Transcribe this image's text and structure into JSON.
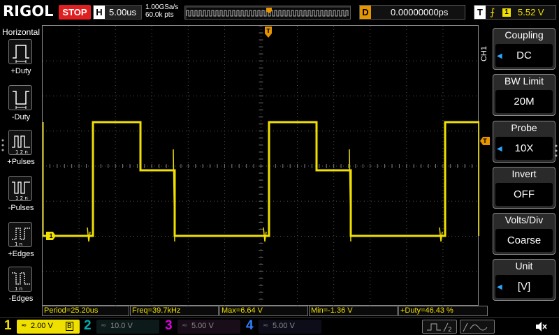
{
  "header": {
    "brand": "RIGOL",
    "run_state": "STOP",
    "horizontal_key": "H",
    "timebase": "5.00us",
    "sample_rate": "1.00GSa/s",
    "memory_depth": "60.0k pts",
    "delay_key": "D",
    "delay_value": "0.00000000ps",
    "trigger_key": "T",
    "trigger_source": "1",
    "trigger_level": "5.52 V"
  },
  "left_panel": {
    "title": "Horizontal",
    "items": [
      {
        "label": "+Duty",
        "icon": "positive-duty-icon"
      },
      {
        "label": "-Duty",
        "icon": "negative-duty-icon"
      },
      {
        "label": "+Pulses",
        "icon": "positive-pulses-icon"
      },
      {
        "label": "-Pulses",
        "icon": "negative-pulses-icon"
      },
      {
        "label": "+Edges",
        "icon": "positive-edges-icon"
      },
      {
        "label": "-Edges",
        "icon": "negative-edges-icon"
      }
    ]
  },
  "grid": {
    "channel_marker": "1",
    "trigger_marker": "T"
  },
  "measurements": {
    "period": "Period=25.20us",
    "freq": "Freq=39.7kHz",
    "max": "Max=6.64 V",
    "min": "Min=-1.36 V",
    "duty": "+Duty=46.43 %"
  },
  "right_menu": {
    "channel_tag": "CH1",
    "items": [
      {
        "title": "Coupling",
        "value": "DC",
        "arrow": true
      },
      {
        "title": "BW Limit",
        "value": "20M",
        "arrow": false
      },
      {
        "title": "Probe",
        "value": "10X",
        "arrow": true
      },
      {
        "title": "Invert",
        "value": "OFF",
        "arrow": false
      },
      {
        "title": "Volts/Div",
        "value": "Coarse",
        "arrow": false
      },
      {
        "title": "Unit",
        "value": "[V]",
        "arrow": true
      }
    ]
  },
  "channels": [
    {
      "num": "1",
      "coupling": "≂",
      "scale": "2.00 V",
      "bw": "B",
      "color": "#f0e000",
      "active": true
    },
    {
      "num": "2",
      "coupling": "≂",
      "scale": "10.0 V",
      "bw": "",
      "color": "#00b0b0",
      "active": false
    },
    {
      "num": "3",
      "coupling": "≂",
      "scale": "5.00 V",
      "bw": "",
      "color": "#e000e0",
      "active": false
    },
    {
      "num": "4",
      "coupling": "≂",
      "scale": "5.00 V",
      "bw": "",
      "color": "#3080ff",
      "active": false
    }
  ],
  "colors": {
    "ch1": "#f0e000",
    "trigger": "#e69500",
    "stop": "#e02020",
    "menu_arrow": "#2aa8ff",
    "grid": "#888888"
  }
}
